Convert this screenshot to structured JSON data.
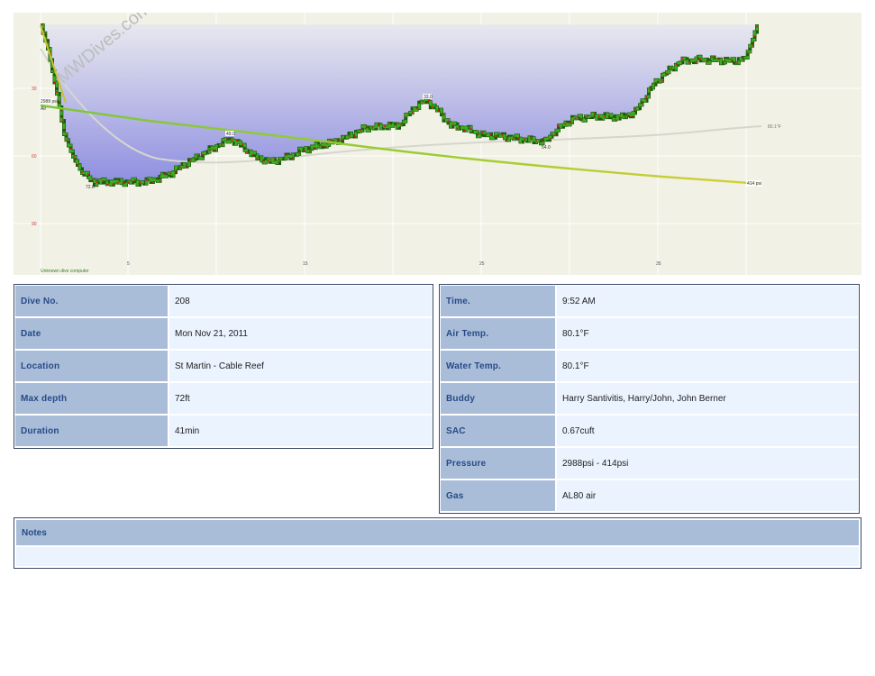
{
  "watermark": "MWDives.com",
  "profile": {
    "depth_axis_labels": [
      "30",
      "60",
      "90"
    ],
    "time_axis_labels": [
      "5",
      "15",
      "25",
      "35"
    ],
    "start_pressure_label": "2988 psi",
    "gas_label": "Air",
    "end_pressure_label": "414 psi",
    "max_depth_label": "72.0",
    "depth_marker_mid": "49.0",
    "depth_marker_peak": "33.0",
    "depth_marker_late": "54.0",
    "temperature_label": "80.1°F",
    "computer_label": "Unknown dive computer",
    "colors": {
      "depth_fill_top": "#e6e6ee",
      "depth_fill_bottom": "#8f8fe0",
      "background": "#f1f1e6",
      "depth_line_green": "#3cae1e",
      "depth_line_red": "#c81e1e",
      "depth_line_dark": "#1e5a10",
      "pressure_line": "#8fcf3a"
    }
  },
  "dive_table": {
    "rows": [
      {
        "label": "Dive No.",
        "value": "208"
      },
      {
        "label": "Date",
        "value": "Mon Nov 21, 2011"
      },
      {
        "label": "Location",
        "value": "St Martin - Cable Reef"
      },
      {
        "label": "Max depth",
        "value": "72ft"
      },
      {
        "label": "Duration",
        "value": "41min"
      }
    ]
  },
  "details_table": {
    "rows": [
      {
        "label": "Time.",
        "value": "9:52 AM"
      },
      {
        "label": "Air Temp.",
        "value": "80.1°F"
      },
      {
        "label": "Water Temp.",
        "value": "80.1°F"
      },
      {
        "label": "Buddy",
        "value": "Harry Santivitis, Harry/John, John Berner"
      },
      {
        "label": "SAC",
        "value": "0.67cuft"
      },
      {
        "label": "Pressure",
        "value": "2988psi - 414psi"
      },
      {
        "label": "Gas",
        "value": "AL80 air"
      }
    ]
  },
  "notes": {
    "label": "Notes",
    "text": ""
  }
}
